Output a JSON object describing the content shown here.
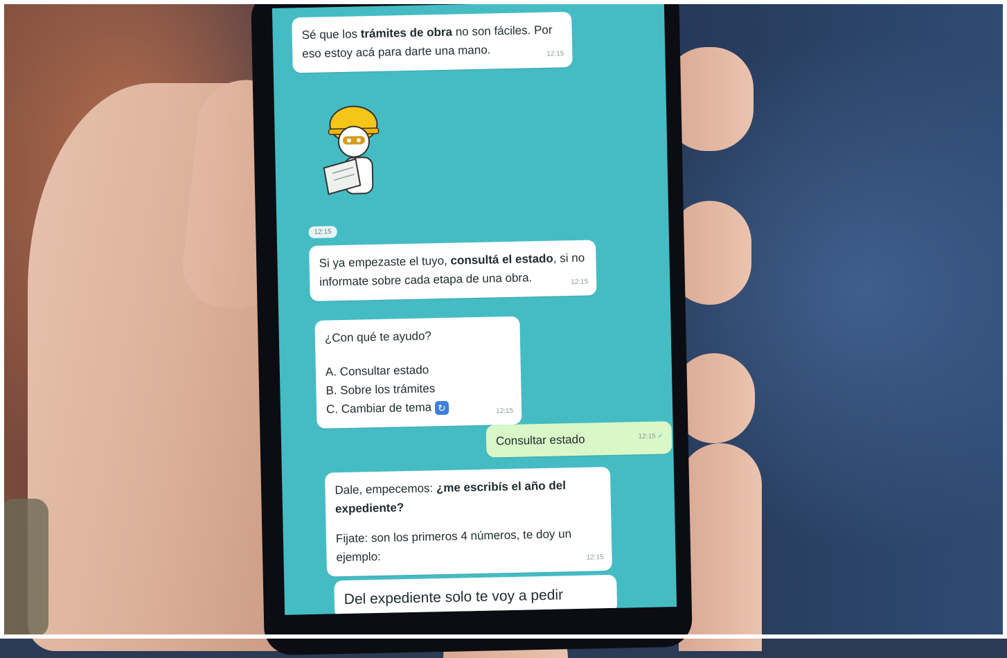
{
  "chat": {
    "m1": {
      "pre": "Sé que los ",
      "bold": "trámites de obra",
      "post": " no son fáciles. Por eso estoy acá para darte una mano.",
      "time": "12:15"
    },
    "sticker": {
      "time": "12:15",
      "icon": "construction-robot-sticker"
    },
    "m2": {
      "pre": "Si ya empezaste el tuyo, ",
      "bold": "consultá el estado",
      "post": ", si no informate sobre cada etapa de una obra.",
      "time": "12:15"
    },
    "m3": {
      "question": "¿Con qué te ayudo?",
      "options": [
        "A. Consultar estado",
        "B. Sobre los trámites",
        "C. Cambiar de tema"
      ],
      "emoji_icon": "refresh-icon",
      "time": "12:15"
    },
    "m4": {
      "text": "Consultar estado",
      "time": "12:15",
      "icon": "check-icon"
    },
    "m5": {
      "pre": "Dale, empecemos: ",
      "bold": "¿me escribís el año del expediente?",
      "note": "Fijate: son los primeros 4 números, te doy un ejemplo:",
      "time": "12:15"
    },
    "m6": {
      "text": "Del expediente solo te voy a pedir"
    }
  },
  "colors": {
    "chat_bg": "#45bcc4",
    "bubble_in": "#ffffff",
    "bubble_out": "#d9f7c7"
  }
}
